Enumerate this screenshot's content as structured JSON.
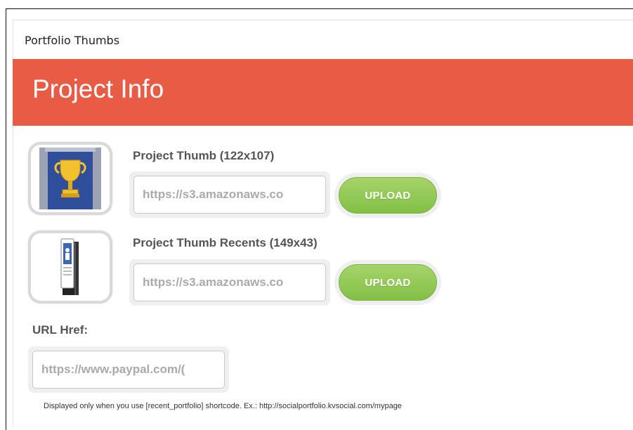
{
  "panel": {
    "title": "Portfolio Thumbs"
  },
  "banner": {
    "title": "Project Info",
    "color": "#e85b44"
  },
  "fields": {
    "project_thumb": {
      "label": "Project Thumb (122x107)",
      "value": "https://s3.amazonaws.co",
      "icon": "trophy-thumbnail",
      "button_label": "UPLOAD"
    },
    "project_thumb_recents": {
      "label": "Project Thumb Recents (149x43)",
      "value": "https://s3.amazonaws.co",
      "icon": "phone-stack-thumbnail",
      "button_label": "UPLOAD"
    },
    "url_href": {
      "label": "URL Href:",
      "value": "https://www.paypal.com/("
    }
  },
  "help_text": "Displayed only when you use [recent_portfolio] shortcode. Ex.: http://socialportfolio.kvsocial.com/mypage",
  "colors": {
    "upload_button": "#8cc44e",
    "label_text": "#555555"
  }
}
